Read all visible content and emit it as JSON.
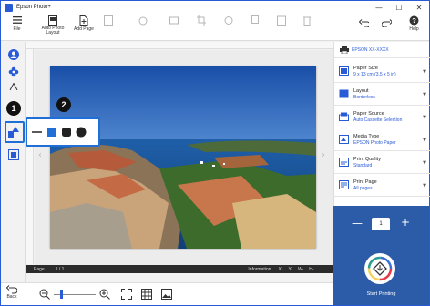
{
  "app": {
    "title": "Epson Photo+"
  },
  "window_controls": {
    "minimize": "—",
    "maximize": "☐",
    "close": "✕"
  },
  "toolbar": {
    "file_label": "File",
    "auto_layout_label": "Auto Photo\nLayout",
    "add_page_label": "Add Page",
    "help_label": "Help"
  },
  "printer": {
    "name": "EPSON XX-XXXX"
  },
  "settings": [
    {
      "name": "Paper Size",
      "value": "9 x 13 cm (3.5 x 5 in)"
    },
    {
      "name": "Layout",
      "value": "Borderless"
    },
    {
      "name": "Paper Source",
      "value": "Auto Cassette Selection"
    },
    {
      "name": "Media Type",
      "value": "EPSON Photo Paper"
    },
    {
      "name": "Print Quality",
      "value": "Standard"
    },
    {
      "name": "Print Page",
      "value": "All pages"
    }
  ],
  "copies": {
    "value": "1",
    "minus": "—",
    "plus": "+"
  },
  "print": {
    "label": "Start Printing"
  },
  "status": {
    "page_label": "Page",
    "page_value": "1 / 1",
    "info_label": "Information",
    "x_label": "X-",
    "y_label": "Y-",
    "w_label": "W-",
    "h_label": "H-"
  },
  "bottom": {
    "back_label": "Back"
  },
  "callouts": [
    "1",
    "2"
  ],
  "colors": {
    "accent": "#2a5bd7",
    "print_panel": "#2c5ca8",
    "sea": "#1f5fa8"
  }
}
